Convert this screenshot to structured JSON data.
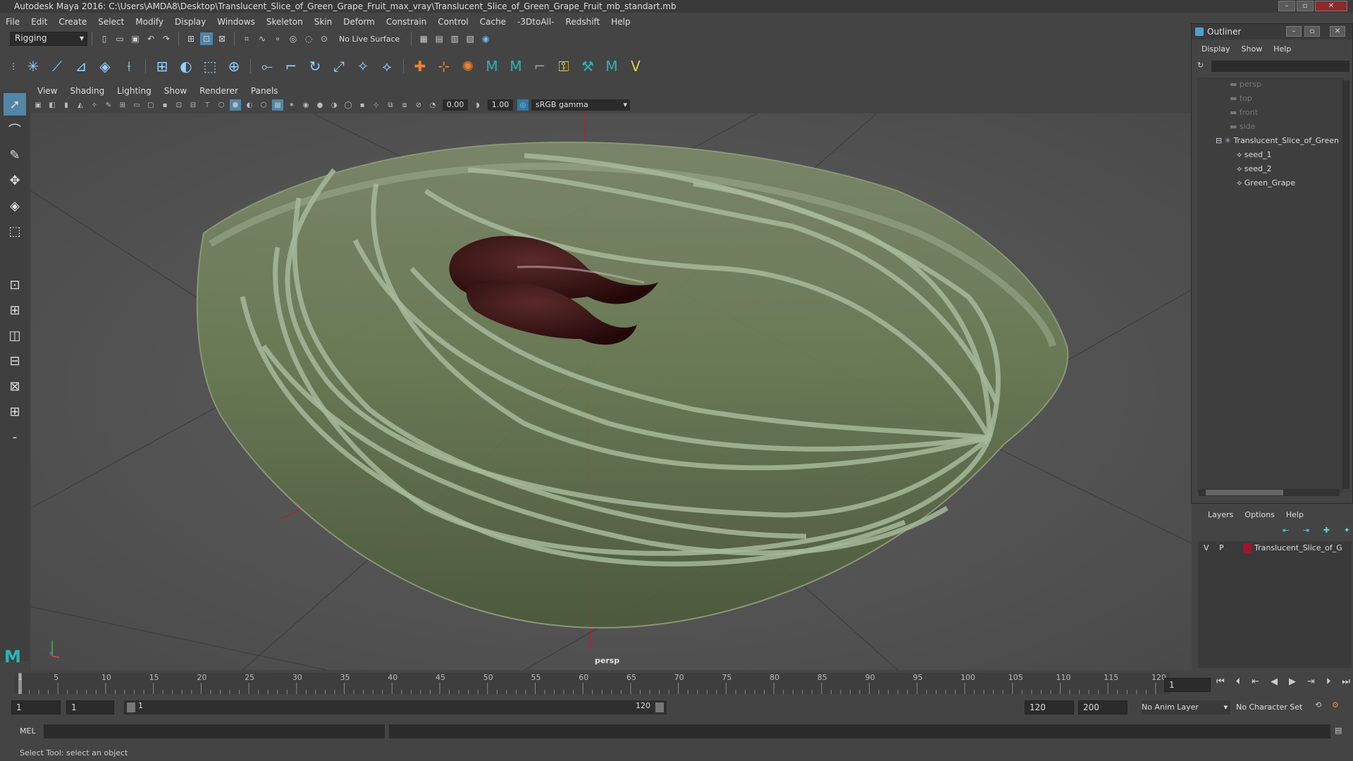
{
  "title": "Autodesk Maya 2016: C:\\Users\\AMDA8\\Desktop\\Translucent_Slice_of_Green_Grape_Fruit_max_vray\\Translucent_Slice_of_Green_Grape_Fruit_mb_standart.mb",
  "menu": [
    "File",
    "Edit",
    "Create",
    "Select",
    "Modify",
    "Display",
    "Windows",
    "Skeleton",
    "Skin",
    "Deform",
    "Constrain",
    "Control",
    "Cache",
    "-3DtoAll-",
    "Redshift",
    "Help"
  ],
  "module": "Rigging",
  "live_surface": "No Live Surface",
  "panel_menu": [
    "View",
    "Shading",
    "Lighting",
    "Show",
    "Renderer",
    "Panels"
  ],
  "panel_toolbar": {
    "exposure": "0.00",
    "gamma": "1.00",
    "colorspace": "sRGB gamma"
  },
  "viewport": {
    "camera_label": "persp"
  },
  "outliner": {
    "title": "Outliner",
    "menu": [
      "Display",
      "Show",
      "Help"
    ],
    "items": [
      "persp",
      "top",
      "front",
      "side",
      "Translucent_Slice_of_Green",
      "seed_1",
      "seed_2",
      "Green_Grape"
    ]
  },
  "layers": {
    "menu": [
      "Layers",
      "Options",
      "Help"
    ],
    "row": {
      "v": "V",
      "p": "P",
      "name": "Translucent_Slice_of_G",
      "color": "#a0142c"
    }
  },
  "timeline": {
    "ticks": [
      "1",
      "5",
      "10",
      "15",
      "20",
      "25",
      "30",
      "35",
      "40",
      "45",
      "50",
      "55",
      "60",
      "65",
      "70",
      "75",
      "80",
      "85",
      "90",
      "95",
      "100",
      "105",
      "110",
      "115",
      "120"
    ],
    "current_frame": "1"
  },
  "range": {
    "start": "1",
    "start2": "1",
    "slider_start": "1",
    "slider_end": "120",
    "end": "120",
    "end2": "200",
    "anim_layer": "No Anim Layer",
    "char_set": "No Character Set"
  },
  "cmd": {
    "label": "MEL"
  },
  "status": "Select Tool: select an object"
}
